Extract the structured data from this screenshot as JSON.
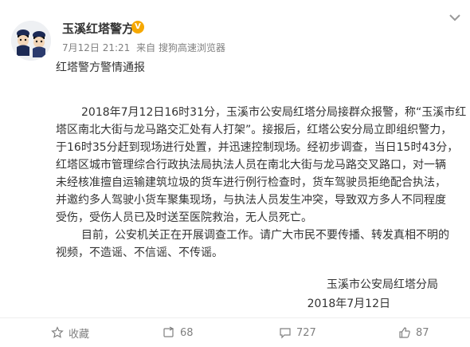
{
  "post": {
    "author": "玉溪红塔警方",
    "verified_badge": "V",
    "time": "7月12日 21:21",
    "source": "来自 搜狗高速浏览器",
    "headline": "红塔警方警情通报",
    "paragraph1_lines": [
      "2018年7月12日16时31分，玉溪市公安局红塔分局接群众报警，称“玉溪市红",
      "塔区南北大街与龙马路交汇处有人打架”。接报后，红塔公安分局立即组织警力，",
      "于16时35分赶到现场进行处置，并迅速控制现场。经初步调查，当日15时43分，",
      "红塔区城市管理综合行政执法局执法人员在南北大街与龙马路交叉路口，对一辆",
      "未经核准擅自运输建筑垃圾的货车进行例行检查时，货车驾驶员拒绝配合执法，",
      "并邀约多人驾驶小货车聚集现场，与执法人员发生冲突，导致双方多人不同程度",
      "受伤，受伤人员已及时送至医院救治，无人员死亡。"
    ],
    "paragraph2_lines": [
      "目前，公安机关正在开展调查工作。请广大市民不要传播、转发真相不明的",
      "视频，不造谣、不信谣、不传谣。"
    ],
    "signature_org": "玉溪市公安局红塔分局",
    "signature_date": "2018年7月12日"
  },
  "actions": {
    "favorite_label": "收藏",
    "repost_count": "68",
    "comment_count": "727",
    "like_count": "87"
  },
  "icons": {
    "avatar": "police-cartoon-avatar",
    "verified": "verified-v-badge",
    "menu": "chevron-down-icon",
    "favorite": "star-icon",
    "repost": "repost-icon",
    "comment": "comment-icon",
    "like": "thumbs-up-icon"
  },
  "colors": {
    "verified": "#f6a800",
    "meta_text": "#808080",
    "body_text": "#333333"
  }
}
